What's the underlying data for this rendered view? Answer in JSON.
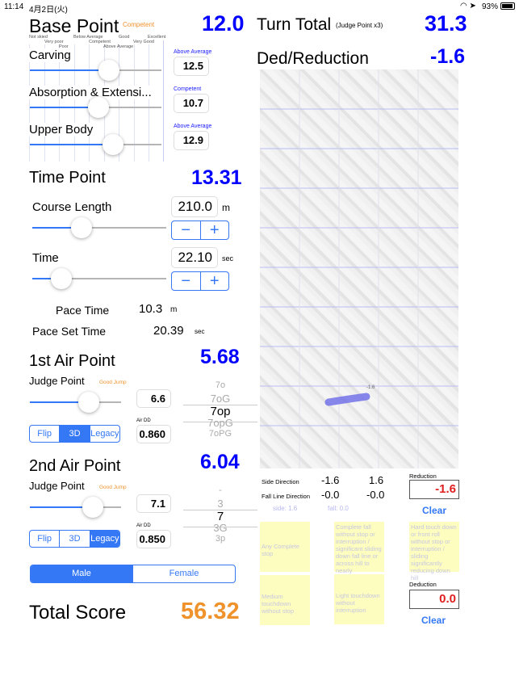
{
  "status": {
    "time": "11:14",
    "date": "4月2日(火)",
    "battery": "93%"
  },
  "base": {
    "title": "Base Point",
    "level": "Competent",
    "score": "12.0",
    "scale": [
      "Not skied",
      "Very poor",
      "Poor",
      "Below Average",
      "Competent",
      "Above Average",
      "Good",
      "Very Good",
      "Excellent"
    ],
    "items": [
      {
        "label": "Carving",
        "level": "Above Average",
        "value": "12.5",
        "pct": 0.6
      },
      {
        "label": "Absorption & Extensi...",
        "level": "Competent",
        "value": "10.7",
        "pct": 0.52
      },
      {
        "label": "Upper Body",
        "level": "Above Average",
        "value": "12.9",
        "pct": 0.63
      }
    ]
  },
  "time": {
    "title": "Time Point",
    "score": "13.31",
    "course_label": "Course Length",
    "course_value": "210.0",
    "course_unit": "m",
    "course_pct": 0.37,
    "time_label": "Time",
    "time_value": "22.10",
    "time_unit": "sec",
    "time_pct": 0.2,
    "minus": "−",
    "plus": "+",
    "pace_label": "Pace Time",
    "pace_value": "10.3",
    "pace_unit": "m",
    "paceset_label": "Pace Set Time",
    "paceset_value": "20.39",
    "paceset_unit": "sec"
  },
  "air1": {
    "title": "1st Air Point",
    "score": "5.68",
    "judge_label": "Judge Point",
    "judge_level": "Good Jump",
    "judge_value": "6.6",
    "pct": 0.63,
    "dd_label": "Air DD",
    "dd_value": "0.860",
    "segments": [
      "Flip",
      "3D",
      "Legacy"
    ],
    "selected": 1,
    "picker": [
      "7o",
      "7oG",
      "7op",
      "7opG",
      "7oPG"
    ],
    "picker_selected": 2
  },
  "air2": {
    "title": "2nd Air Point",
    "score": "6.04",
    "judge_label": "Judge Point",
    "judge_level": "Good Jump",
    "judge_value": "7.1",
    "pct": 0.67,
    "dd_label": "Air DD",
    "dd_value": "0.850",
    "segments": [
      "Flip",
      "3D",
      "Legacy"
    ],
    "selected": 2,
    "picker": [
      "-",
      "3",
      "7",
      "3G",
      "3p"
    ],
    "picker_selected": 2
  },
  "gender": {
    "options": [
      "Male",
      "Female"
    ],
    "selected": 0
  },
  "total": {
    "label": "Total Score",
    "value": "56.32"
  },
  "turn": {
    "title": "Turn Total",
    "sub": "(Judge Point x3)",
    "value": "31.3"
  },
  "ded": {
    "title": "Ded/Reduction",
    "value": "-1.6",
    "mark_label": "-1.6",
    "side_label": "Side Direction",
    "side_a": "-1.6",
    "side_b": "1.6",
    "fall_label": "Fall Line Direction",
    "fall_a": "-0.0",
    "fall_b": "-0.0",
    "side_small": "side:   1.6",
    "fall_small": "fall:   0.0",
    "reduction_label": "Reduction",
    "reduction_value": "-1.6",
    "deduction_label": "Deduction",
    "deduction_value": "0.0",
    "clear": "Clear",
    "boxes": [
      "Any Complete stop",
      "Complete fall without stop or interruption / significant sliding down fall line or across hill to nearly",
      "Hard touch down or front roll without stop or interruption / sliding significantly reducing down hill",
      "Medium touchdown without stop",
      "Light touchdown without interruption"
    ]
  },
  "colors": {
    "accent": "#3478f6",
    "score": "#0000ff",
    "total": "#f0922c",
    "reduction": "#e02020"
  }
}
